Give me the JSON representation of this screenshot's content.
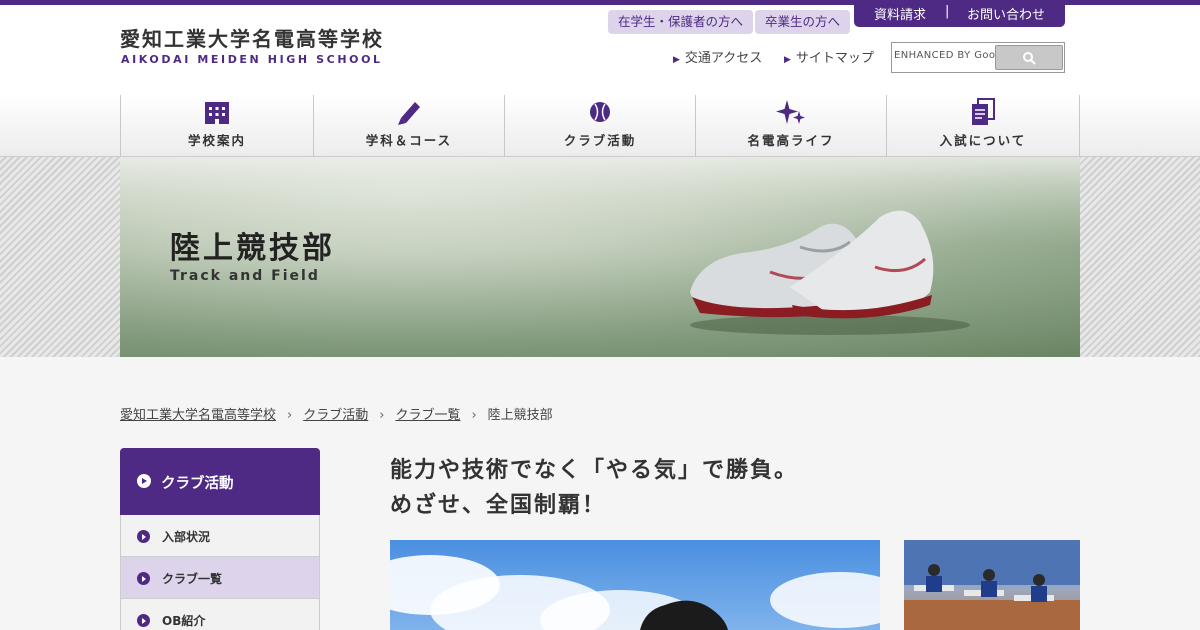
{
  "header": {
    "logo_jp": "愛知工業大学名電高等学校",
    "logo_en": "AIKODAI MEIDEN HIGH SCHOOL",
    "pills": [
      "在学生・保護者の方へ",
      "卒業生の方へ"
    ],
    "top_buttons": [
      "資料請求",
      "お問い合わせ"
    ],
    "top_buttons_sep": "|",
    "subnav": [
      "交通アクセス",
      "サイトマップ"
    ],
    "search_placeholder": "ENHANCED BY Google"
  },
  "global_nav": [
    {
      "label": "学校案内",
      "icon": "building-icon"
    },
    {
      "label": "学科＆コース",
      "icon": "pencil-icon"
    },
    {
      "label": "クラブ活動",
      "icon": "ball-icon"
    },
    {
      "label": "名電高ライフ",
      "icon": "sparkle-icon"
    },
    {
      "label": "入試について",
      "icon": "document-icon"
    }
  ],
  "hero": {
    "title": "陸上競技部",
    "subtitle": "Track and Field"
  },
  "breadcrumb": {
    "items": [
      "愛知工業大学名電高等学校",
      "クラブ活動",
      "クラブ一覧",
      "陸上競技部"
    ],
    "separator": "›"
  },
  "sidebar": {
    "heading": "クラブ活動",
    "items": [
      {
        "label": "入部状況",
        "active": false
      },
      {
        "label": "クラブ一覧",
        "active": true
      },
      {
        "label": "OB紹介",
        "active": false
      }
    ]
  },
  "main": {
    "catch_line1": "能力や技術でなく「やる気」で勝負。",
    "catch_line2": "めざせ、全国制覇！"
  },
  "colors": {
    "brand": "#4e2a84",
    "brand_light": "#ddd3ea",
    "background": "#f5f5f5"
  }
}
